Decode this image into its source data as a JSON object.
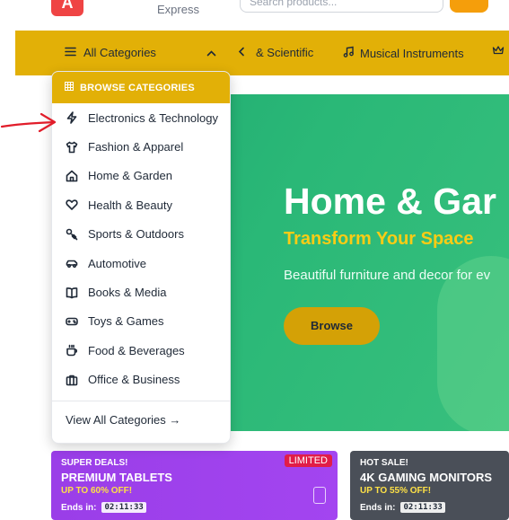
{
  "header": {
    "logo_letter": "A",
    "tagline": "Express",
    "search_placeholder": "Search products..."
  },
  "nav": {
    "all_categories": "All Categories",
    "links": [
      {
        "label": "& Scientific",
        "icon": "none"
      },
      {
        "label": "Musical Instruments",
        "icon": "music-note-icon"
      }
    ]
  },
  "dropdown": {
    "header": "BROWSE CATEGORIES",
    "items": [
      {
        "label": "Electronics & Technology",
        "icon": "lightning-icon"
      },
      {
        "label": "Fashion & Apparel",
        "icon": "shirt-icon"
      },
      {
        "label": "Home & Garden",
        "icon": "home-icon"
      },
      {
        "label": "Health & Beauty",
        "icon": "heart-icon"
      },
      {
        "label": "Sports & Outdoors",
        "icon": "sports-icon"
      },
      {
        "label": "Automotive",
        "icon": "car-icon"
      },
      {
        "label": "Books & Media",
        "icon": "book-icon"
      },
      {
        "label": "Toys & Games",
        "icon": "gamepad-icon"
      },
      {
        "label": "Food & Beverages",
        "icon": "cup-icon"
      },
      {
        "label": "Office & Business",
        "icon": "briefcase-icon"
      }
    ],
    "view_all": "View All Categories →"
  },
  "hero": {
    "title": "Home & Gar",
    "subtitle": "Transform Your Space",
    "description": "Beautiful furniture and decor for ev",
    "button": "Browse"
  },
  "deals": [
    {
      "kicker": "SUPER DEALS!",
      "title": "PREMIUM TABLETS",
      "discount": "UP TO 60% OFF!",
      "ends_label": "Ends in:",
      "timer": "02:11:33",
      "badge": "LIMITED"
    },
    {
      "kicker": "HOT SALE!",
      "title": "4K GAMING MONITORS",
      "discount": "UP TO 55% OFF!",
      "ends_label": "Ends in:",
      "timer": "02:11:33"
    }
  ],
  "colors": {
    "brand_yellow": "#e2b007",
    "hero_green": "#2ab877",
    "logo_red": "#ef4444",
    "deal_purple": "#a345f0",
    "annotation_red": "#e11d2a"
  }
}
